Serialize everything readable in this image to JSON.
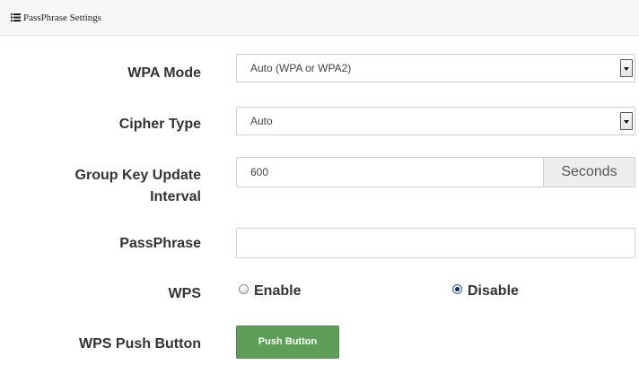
{
  "panel": {
    "icon": "list-icon",
    "title": "PassPhrase Settings"
  },
  "form": {
    "wpa_mode": {
      "label": "WPA Mode",
      "selected": "Auto (WPA or WPA2)"
    },
    "cipher_type": {
      "label": "Cipher Type",
      "selected": "Auto"
    },
    "group_key": {
      "label_line1": "Group Key Update",
      "label_line2": "Interval",
      "value": "600",
      "unit": "Seconds"
    },
    "passphrase": {
      "label": "PassPhrase",
      "value": ""
    },
    "wps": {
      "label": "WPS",
      "options": [
        {
          "label": "Enable",
          "checked": false
        },
        {
          "label": "Disable",
          "checked": true
        }
      ]
    },
    "wps_push": {
      "label": "WPS Push Button",
      "button_label": "Push Button"
    }
  },
  "colors": {
    "button_green": "#5d9e58",
    "header_bg": "#f7f7f7"
  }
}
